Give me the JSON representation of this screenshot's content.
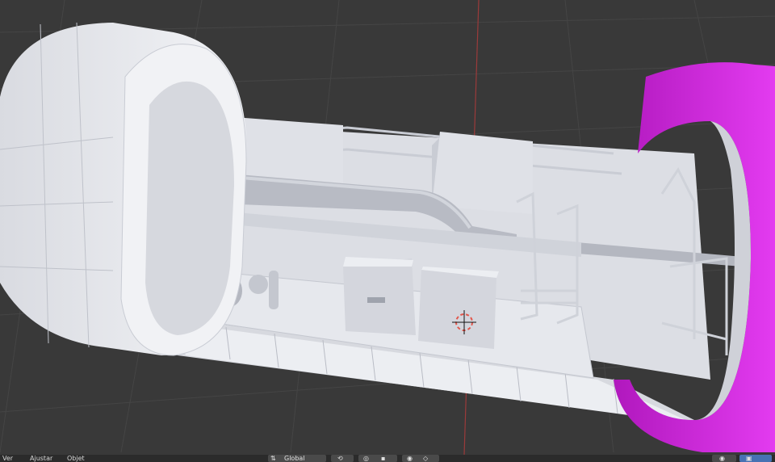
{
  "header_menu": {
    "items": [
      {
        "label": "Ver"
      },
      {
        "label": "Ajustar"
      },
      {
        "label": "Objet"
      }
    ]
  },
  "transform": {
    "orientation_icon": "transform-orientation-icon",
    "orientation_value": "Global"
  },
  "icons": {
    "pivot": "pivot-point-icon",
    "snap": "snap-magnet-icon",
    "proportional": "proportional-edit-icon",
    "visibility": "eye-icon",
    "overlays": "overlays-icon",
    "cursor": "3d-cursor-icon"
  },
  "colors": {
    "viewport_bg": "#393939",
    "grid_line": "#444444",
    "axis_y": "#9b3a3a",
    "model_white": "#e4e5ea",
    "model_shade": "#c9cbd3",
    "selected_magenta": "#d61ee0"
  }
}
